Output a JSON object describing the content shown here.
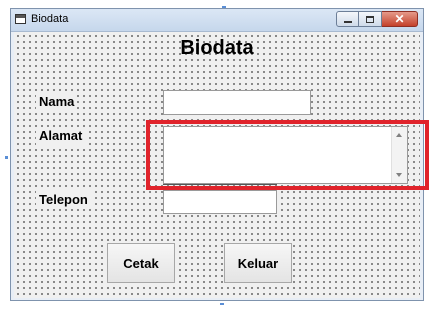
{
  "window": {
    "title": "Biodata",
    "icon": "form-icon",
    "caption_buttons": [
      "minimize-icon",
      "maximize-icon",
      "close-icon"
    ]
  },
  "form": {
    "heading": "Biodata",
    "labels": {
      "nama": "Nama",
      "alamat": "Alamat",
      "telepon": "Telepon"
    },
    "fields": {
      "nama_value": "",
      "alamat_value": "",
      "telepon_value": ""
    }
  },
  "buttons": {
    "cetak": "Cetak",
    "keluar": "Keluar"
  },
  "colors": {
    "highlight": "#e0232b",
    "close_button": "#c4412b"
  }
}
